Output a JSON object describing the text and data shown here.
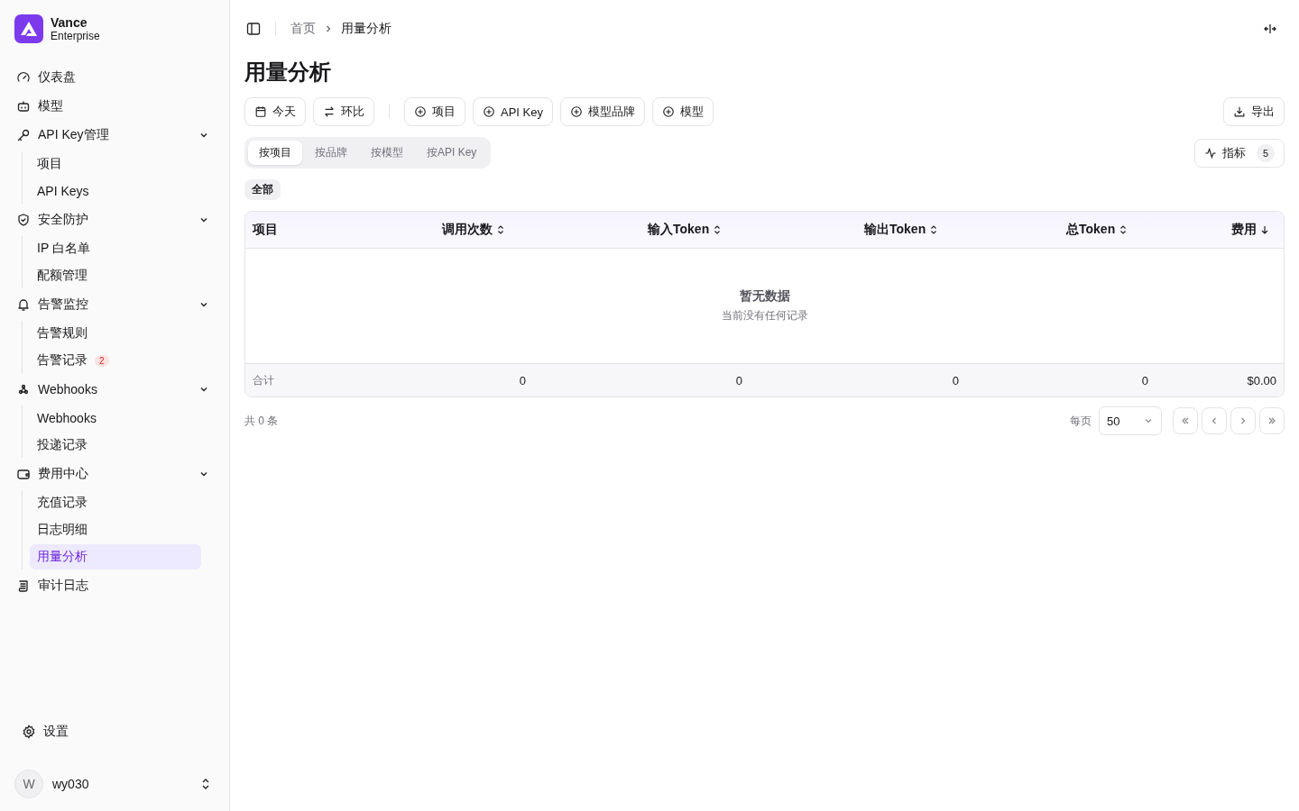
{
  "brand": {
    "name": "Vance",
    "subtitle": "Enterprise"
  },
  "nav": [
    {
      "label": "仪表盘",
      "selected": false
    },
    {
      "label": "模型",
      "selected": false
    },
    {
      "label": "API Key管理",
      "expanded": true,
      "selected": false,
      "children": [
        {
          "label": "项目",
          "selected": false
        },
        {
          "label": "API Keys",
          "selected": false
        }
      ]
    },
    {
      "label": "安全防护",
      "expanded": true,
      "selected": false,
      "children": [
        {
          "label": "IP 白名单",
          "selected": false
        },
        {
          "label": "配额管理",
          "selected": false
        }
      ]
    },
    {
      "label": "告警监控",
      "expanded": true,
      "selected": false,
      "children": [
        {
          "label": "告警规则",
          "selected": false
        },
        {
          "label": "告警记录",
          "badge": "2",
          "selected": false
        }
      ]
    },
    {
      "label": "Webhooks",
      "expanded": true,
      "selected": false,
      "children": [
        {
          "label": "Webhooks",
          "selected": false
        },
        {
          "label": "投递记录",
          "selected": false
        }
      ]
    },
    {
      "label": "费用中心",
      "expanded": true,
      "selected": false,
      "children": [
        {
          "label": "充值记录",
          "selected": false
        },
        {
          "label": "日志明细",
          "selected": false
        },
        {
          "label": "用量分析",
          "selected": true
        }
      ]
    },
    {
      "label": "审计日志",
      "selected": false
    }
  ],
  "settings": {
    "label": "设置"
  },
  "user": {
    "initial": "W",
    "name": "wy030"
  },
  "breadcrumb": [
    "首页",
    "用量分析"
  ],
  "title": "用量分析",
  "filters": [
    {
      "label": "今天"
    },
    {
      "label": "环比"
    }
  ],
  "add_filters": [
    "项目",
    "API Key",
    "模型品牌",
    "模型"
  ],
  "export": {
    "label": "导出"
  },
  "tabs": [
    {
      "label": "按项目",
      "selected": true
    },
    {
      "label": "按品牌",
      "selected": false
    },
    {
      "label": "按模型",
      "selected": false
    },
    {
      "label": "按API Key",
      "selected": false
    }
  ],
  "metrics": {
    "label": "指标",
    "count": "5"
  },
  "chip": {
    "label": "全部"
  },
  "table": {
    "columns": [
      {
        "label": "项目"
      },
      {
        "label": "调用次数"
      },
      {
        "label": "输入Token"
      },
      {
        "label": "输出Token"
      },
      {
        "label": "总Token"
      },
      {
        "label": "费用"
      }
    ],
    "empty_title": "暂无数据",
    "empty_text": "当前没有任何记录",
    "totals": [
      "合计",
      "0",
      "0",
      "0",
      "0",
      "$0.00"
    ]
  },
  "pagination": {
    "total": "共 0 条",
    "per_page_label": "每页",
    "per_page": "50"
  }
}
